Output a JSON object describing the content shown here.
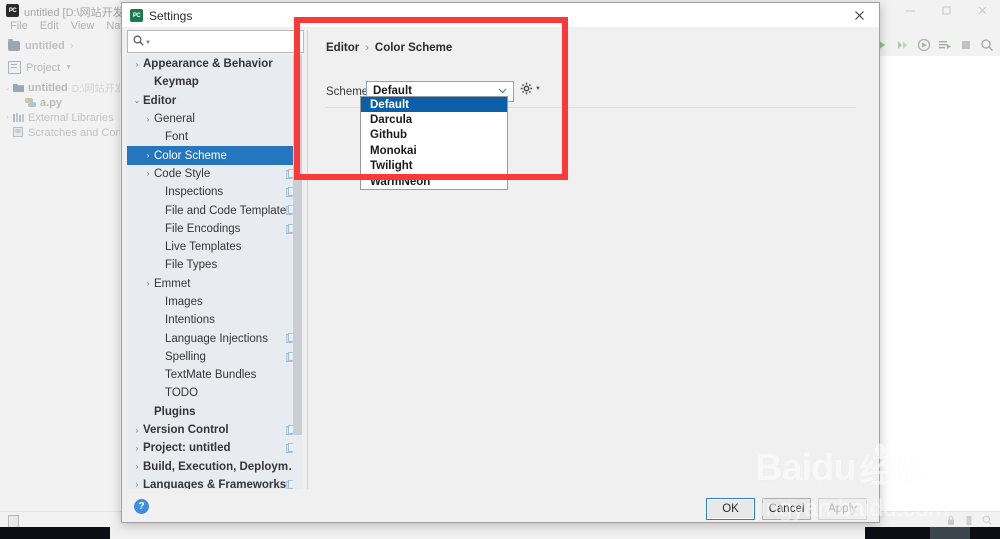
{
  "ide": {
    "title": "untitled [D:\\网站开发工具\\",
    "icon": "pycharm-icon",
    "menus": [
      "File",
      "Edit",
      "View",
      "Navigate"
    ],
    "breadcrumb": {
      "folder": "untitled",
      "separator": "›"
    },
    "project_panel": {
      "header": "Project",
      "items": [
        {
          "label": "untitled",
          "path": "D:\\网站开发工",
          "icon": "folder-icon",
          "bold": true,
          "arrow": "⌄",
          "indent": 0
        },
        {
          "label": "a.py",
          "path": "",
          "icon": "python-file-icon",
          "bold": true,
          "arrow": "",
          "indent": 1
        },
        {
          "label": "External Libraries",
          "path": "",
          "icon": "library-icon",
          "bold": false,
          "arrow": "›",
          "indent": 0
        },
        {
          "label": "Scratches and Consoles",
          "path": "",
          "icon": "scratches-icon",
          "bold": false,
          "arrow": "",
          "indent": 0
        }
      ]
    },
    "toolbar_icons": [
      "run-icon",
      "debug-icon",
      "coverage-icon",
      "profile-icon",
      "stop-icon",
      "search-everywhere-icon"
    ],
    "window_controls": [
      "minimize-icon",
      "maximize-icon",
      "close-icon"
    ],
    "status_icons": [
      "event-log-icon",
      "lock-icon",
      "search-icon"
    ]
  },
  "dialog": {
    "title": "Settings",
    "close_label": "✕",
    "search": {
      "value": "",
      "placeholder": ""
    },
    "tree": [
      {
        "label": "Appearance & Behavior",
        "arrow": "›",
        "indent": 0,
        "bold": true,
        "selected": false,
        "copy": false
      },
      {
        "label": "Keymap",
        "arrow": "",
        "indent": 1,
        "bold": true,
        "selected": false,
        "copy": false
      },
      {
        "label": "Editor",
        "arrow": "⌄",
        "indent": 0,
        "bold": true,
        "selected": false,
        "copy": false
      },
      {
        "label": "General",
        "arrow": "›",
        "indent": 1,
        "bold": false,
        "selected": false,
        "copy": false
      },
      {
        "label": "Font",
        "arrow": "",
        "indent": 2,
        "bold": false,
        "selected": false,
        "copy": false
      },
      {
        "label": "Color Scheme",
        "arrow": "›",
        "indent": 1,
        "bold": false,
        "selected": true,
        "copy": false
      },
      {
        "label": "Code Style",
        "arrow": "›",
        "indent": 1,
        "bold": false,
        "selected": false,
        "copy": true
      },
      {
        "label": "Inspections",
        "arrow": "",
        "indent": 2,
        "bold": false,
        "selected": false,
        "copy": true
      },
      {
        "label": "File and Code Templates",
        "arrow": "",
        "indent": 2,
        "bold": false,
        "selected": false,
        "copy": true
      },
      {
        "label": "File Encodings",
        "arrow": "",
        "indent": 2,
        "bold": false,
        "selected": false,
        "copy": true
      },
      {
        "label": "Live Templates",
        "arrow": "",
        "indent": 2,
        "bold": false,
        "selected": false,
        "copy": false
      },
      {
        "label": "File Types",
        "arrow": "",
        "indent": 2,
        "bold": false,
        "selected": false,
        "copy": false
      },
      {
        "label": "Emmet",
        "arrow": "›",
        "indent": 1,
        "bold": false,
        "selected": false,
        "copy": false
      },
      {
        "label": "Images",
        "arrow": "",
        "indent": 2,
        "bold": false,
        "selected": false,
        "copy": false
      },
      {
        "label": "Intentions",
        "arrow": "",
        "indent": 2,
        "bold": false,
        "selected": false,
        "copy": false
      },
      {
        "label": "Language Injections",
        "arrow": "",
        "indent": 2,
        "bold": false,
        "selected": false,
        "copy": true
      },
      {
        "label": "Spelling",
        "arrow": "",
        "indent": 2,
        "bold": false,
        "selected": false,
        "copy": true
      },
      {
        "label": "TextMate Bundles",
        "arrow": "",
        "indent": 2,
        "bold": false,
        "selected": false,
        "copy": false
      },
      {
        "label": "TODO",
        "arrow": "",
        "indent": 2,
        "bold": false,
        "selected": false,
        "copy": false
      },
      {
        "label": "Plugins",
        "arrow": "",
        "indent": 1,
        "bold": true,
        "selected": false,
        "copy": false
      },
      {
        "label": "Version Control",
        "arrow": "›",
        "indent": 0,
        "bold": true,
        "selected": false,
        "copy": true
      },
      {
        "label": "Project: untitled",
        "arrow": "›",
        "indent": 0,
        "bold": true,
        "selected": false,
        "copy": true
      },
      {
        "label": "Build, Execution, Deployment",
        "arrow": "›",
        "indent": 0,
        "bold": true,
        "selected": false,
        "copy": false
      },
      {
        "label": "Languages & Frameworks",
        "arrow": "›",
        "indent": 0,
        "bold": true,
        "selected": false,
        "copy": true
      }
    ],
    "content": {
      "breadcrumb_root": "Editor",
      "breadcrumb_sep": "›",
      "breadcrumb_leaf": "Color Scheme",
      "scheme_label": "Scheme:",
      "scheme_value": "Default",
      "gear_icon": "gear-icon"
    },
    "dropdown": {
      "options": [
        "Default",
        "Darcula",
        "Github",
        "Monokai",
        "Twilight",
        "WarmNeon"
      ],
      "selected_index": 0
    },
    "footer": {
      "help_label": "?",
      "ok_label": "OK",
      "cancel_label": "Cancel",
      "apply_label": "Apply"
    }
  },
  "annotation": {
    "color": "#fa3a3a",
    "shape": "rectangle"
  },
  "watermark": {
    "brand": "Baidu",
    "cn": "经验",
    "url": "jingyan.baidu.com"
  }
}
